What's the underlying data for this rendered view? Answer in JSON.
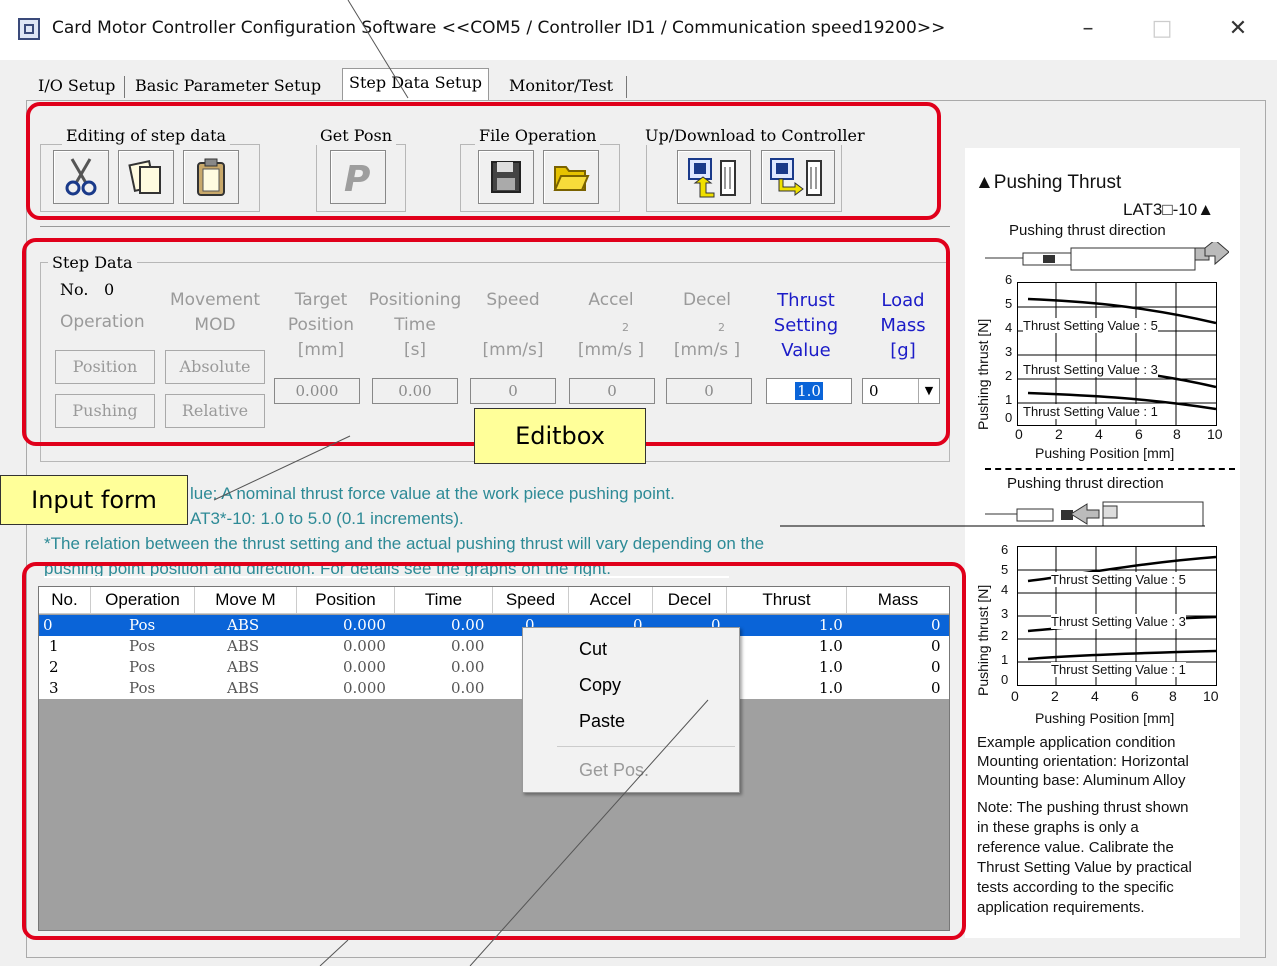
{
  "window": {
    "title": "Card Motor Controller Configuration Software <<COM5 / Controller ID1 / Communication speed19200>>",
    "minimize": "–",
    "maximize": "□",
    "close": "✕"
  },
  "tabs": [
    {
      "label": "I/O Setup"
    },
    {
      "label": "Basic Parameter Setup"
    },
    {
      "label": "Step Data Setup"
    },
    {
      "label": "Monitor/Test"
    }
  ],
  "toolbar": {
    "editing_title": "Editing of step data",
    "get_posn_title": "Get Posn",
    "file_title": "File Operation",
    "updown_title": "Up/Download to Controller"
  },
  "step_data": {
    "group_title": "Step Data",
    "no_label": "No.",
    "no_value": "0",
    "operation_label": "Operation",
    "movement_label": "Movement",
    "mod_label": "MOD",
    "target_label_1": "Target",
    "target_label_2": "Position",
    "target_label_3": "[mm]",
    "positioning_label_1": "Positioning",
    "positioning_label_2": "Time",
    "positioning_label_3": "[s]",
    "speed_label": "Speed",
    "speed_unit": "[mm/s]",
    "accel_label": "Accel",
    "accel_unit": "[mm/s ]",
    "accel_sup": "2",
    "decel_label": "Decel",
    "decel_unit": "[mm/s ]",
    "decel_sup": "2",
    "thrust_label_1": "Thrust",
    "thrust_label_2": "Setting",
    "thrust_label_3": "Value",
    "load_label_1": "Load",
    "load_label_2": "Mass",
    "load_label_3": "[g]",
    "btn_position": "Position",
    "btn_pushing": "Pushing",
    "btn_absolute": "Absolute",
    "btn_relative": "Relative",
    "target_value": "0.000",
    "time_value": "0.00",
    "speed_value": "0",
    "accel_value": "0",
    "decel_value": "0",
    "thrust_value": "1.0",
    "load_value": "0"
  },
  "callouts": {
    "editbox": "Editbox",
    "input_form": "Input form"
  },
  "notes": {
    "line1": "lue: A nominal thrust force value at the work piece pushing point.",
    "line2": "AT3*-10: 1.0 to 5.0 (0.1 increments).",
    "line3": "*The relation between the thrust setting and the actual pushing thrust will vary depending on the",
    "line4": "pushing point position and direction. For details see the graphs on the right."
  },
  "table": {
    "headers": [
      "No.",
      "Operation",
      "Move M",
      "Position",
      "Time",
      "Speed",
      "Accel",
      "Decel",
      "Thrust",
      "Mass"
    ],
    "rows": [
      {
        "no": "0",
        "op": "Pos",
        "move": "ABS",
        "pos": "0.000",
        "time": "0.00",
        "speed": "0",
        "accel": "0",
        "decel": "0",
        "thrust": "1.0",
        "mass": "0"
      },
      {
        "no": "1",
        "op": "Pos",
        "move": "ABS",
        "pos": "0.000",
        "time": "0.00",
        "speed": "",
        "accel": "",
        "decel": "",
        "thrust": "1.0",
        "mass": "0"
      },
      {
        "no": "2",
        "op": "Pos",
        "move": "ABS",
        "pos": "0.000",
        "time": "0.00",
        "speed": "",
        "accel": "",
        "decel": "",
        "thrust": "1.0",
        "mass": "0"
      },
      {
        "no": "3",
        "op": "Pos",
        "move": "ABS",
        "pos": "0.000",
        "time": "0.00",
        "speed": "",
        "accel": "",
        "decel": "",
        "thrust": "1.0",
        "mass": "0"
      }
    ]
  },
  "context_menu": {
    "cut": "Cut",
    "copy": "Copy",
    "paste": "Paste",
    "get_pos": "Get Pos."
  },
  "side_panel": {
    "title": "▲Pushing Thrust",
    "model": "LAT3□-10▲",
    "dir_label_1": "Pushing thrust direction",
    "dir_label_2": "Pushing thrust direction",
    "y_axis": "Pushing thrust [N]",
    "x_axis": "Pushing Position [mm]",
    "curve_labels": [
      "Thrust Setting Value : 5",
      "Thrust Setting Value : 3",
      "Thrust Setting Value : 1"
    ],
    "y_ticks": [
      "6",
      "5",
      "4",
      "3",
      "2",
      "1",
      "0"
    ],
    "x_ticks": [
      "0",
      "2",
      "4",
      "6",
      "8",
      "10"
    ],
    "example_1": "Example application condition",
    "example_2": "Mounting orientation: Horizontal",
    "example_3": "Mounting base: Aluminum Alloy",
    "note_1": "Note: The pushing thrust shown",
    "note_2": "in these graphs is only a",
    "note_3": "reference value.  Calibrate the",
    "note_4": "Thrust Setting Value by practical",
    "note_5": "tests according to the specific",
    "note_6": "application requirements."
  }
}
